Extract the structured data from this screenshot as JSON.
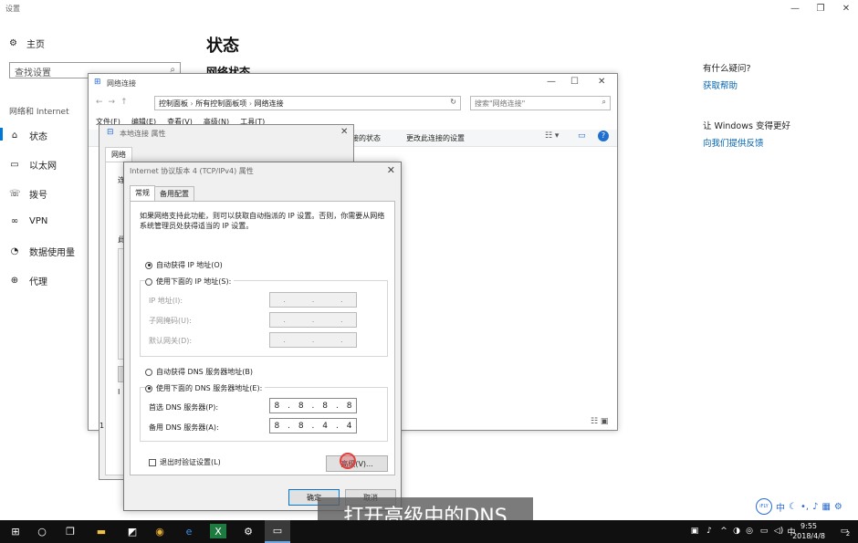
{
  "settings": {
    "app_title": "设置",
    "home_label": "主页",
    "search_placeholder": "查找设置",
    "section_label": "网络和 Internet",
    "nav": [
      {
        "label": "状态",
        "icon": "home-icon"
      },
      {
        "label": "以太网",
        "icon": "ethernet-icon"
      },
      {
        "label": "拨号",
        "icon": "dialup-icon"
      },
      {
        "label": "VPN",
        "icon": "vpn-icon"
      },
      {
        "label": "数据使用量",
        "icon": "data-usage-icon"
      },
      {
        "label": "代理",
        "icon": "globe-icon"
      }
    ],
    "page_title": "状态",
    "page_subtitle": "网络状态",
    "help_heading": "有什么疑问?",
    "help_link": "获取帮助",
    "feedback_heading": "让 Windows 变得更好",
    "feedback_link": "向我们提供反馈"
  },
  "net_connections": {
    "title": "网络连接",
    "breadcrumb": [
      "控制面板",
      "所有控制面板项",
      "网络连接"
    ],
    "search_placeholder": "搜索\"网络连接\"",
    "menu": [
      "文件(F)",
      "编辑(E)",
      "查看(V)",
      "高级(N)",
      "工具(T)"
    ],
    "commands": [
      "接的状态",
      "更改此连接的设置"
    ]
  },
  "local_props": {
    "title": "本地连接 属性",
    "tab": "网络",
    "fragments": [
      "连",
      "此",
      "1",
      "I"
    ]
  },
  "tcp_dialog": {
    "title": "Internet 协议版本 4 (TCP/IPv4) 属性",
    "tabs": [
      "常规",
      "备用配置"
    ],
    "description": "如果网络支持此功能，则可以获取自动指派的 IP 设置。否则，你需要从网络系统管理员处获得适当的 IP 设置。",
    "auto_ip_label": "自动获得 IP 地址(O)",
    "manual_ip_label": "使用下面的 IP 地址(S):",
    "ip_label": "IP 地址(I):",
    "subnet_label": "子网掩码(U):",
    "gateway_label": "默认网关(D):",
    "auto_dns_label": "自动获得 DNS 服务器地址(B)",
    "manual_dns_label": "使用下面的 DNS 服务器地址(E):",
    "preferred_dns_label": "首选 DNS 服务器(P):",
    "preferred_dns": [
      "8",
      "8",
      "8",
      "8"
    ],
    "alternate_dns_label": "备用 DNS 服务器(A):",
    "alternate_dns": [
      "8",
      "8",
      "4",
      "4"
    ],
    "validate_label": "退出时验证设置(L)",
    "advanced_label": "高级(V)...",
    "ok_label": "确定",
    "cancel_label": "取消"
  },
  "subtitle": "打开高级中的DNS",
  "ime": {
    "mode": "中",
    "logo": "iFLY"
  },
  "taskbar": {
    "time": "9:55",
    "date": "2018/4/8",
    "ime_indicator": "中",
    "notification_count": "2"
  }
}
